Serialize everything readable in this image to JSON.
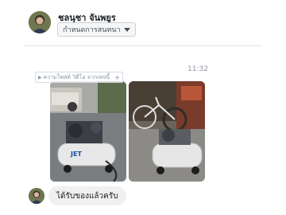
{
  "header": {
    "contact_name": "ชลนุชา จันพยูร",
    "settings_label": "กำหนดการสนทนา"
  },
  "thread": {
    "timestamp": "11:32",
    "media_badge": "ความโพสต์ วิดีโอ จากเพจนี้"
  },
  "message": {
    "text": "ได้รับของแล้วครับ"
  },
  "icons": {
    "settings_caret": "caret-down-icon",
    "badge_play": "play-icon",
    "badge_plus": "plus-icon"
  },
  "colors": {
    "bubble_bg": "#f1f0f0",
    "divider": "#e5e5e5",
    "timestamp": "#90949c"
  }
}
